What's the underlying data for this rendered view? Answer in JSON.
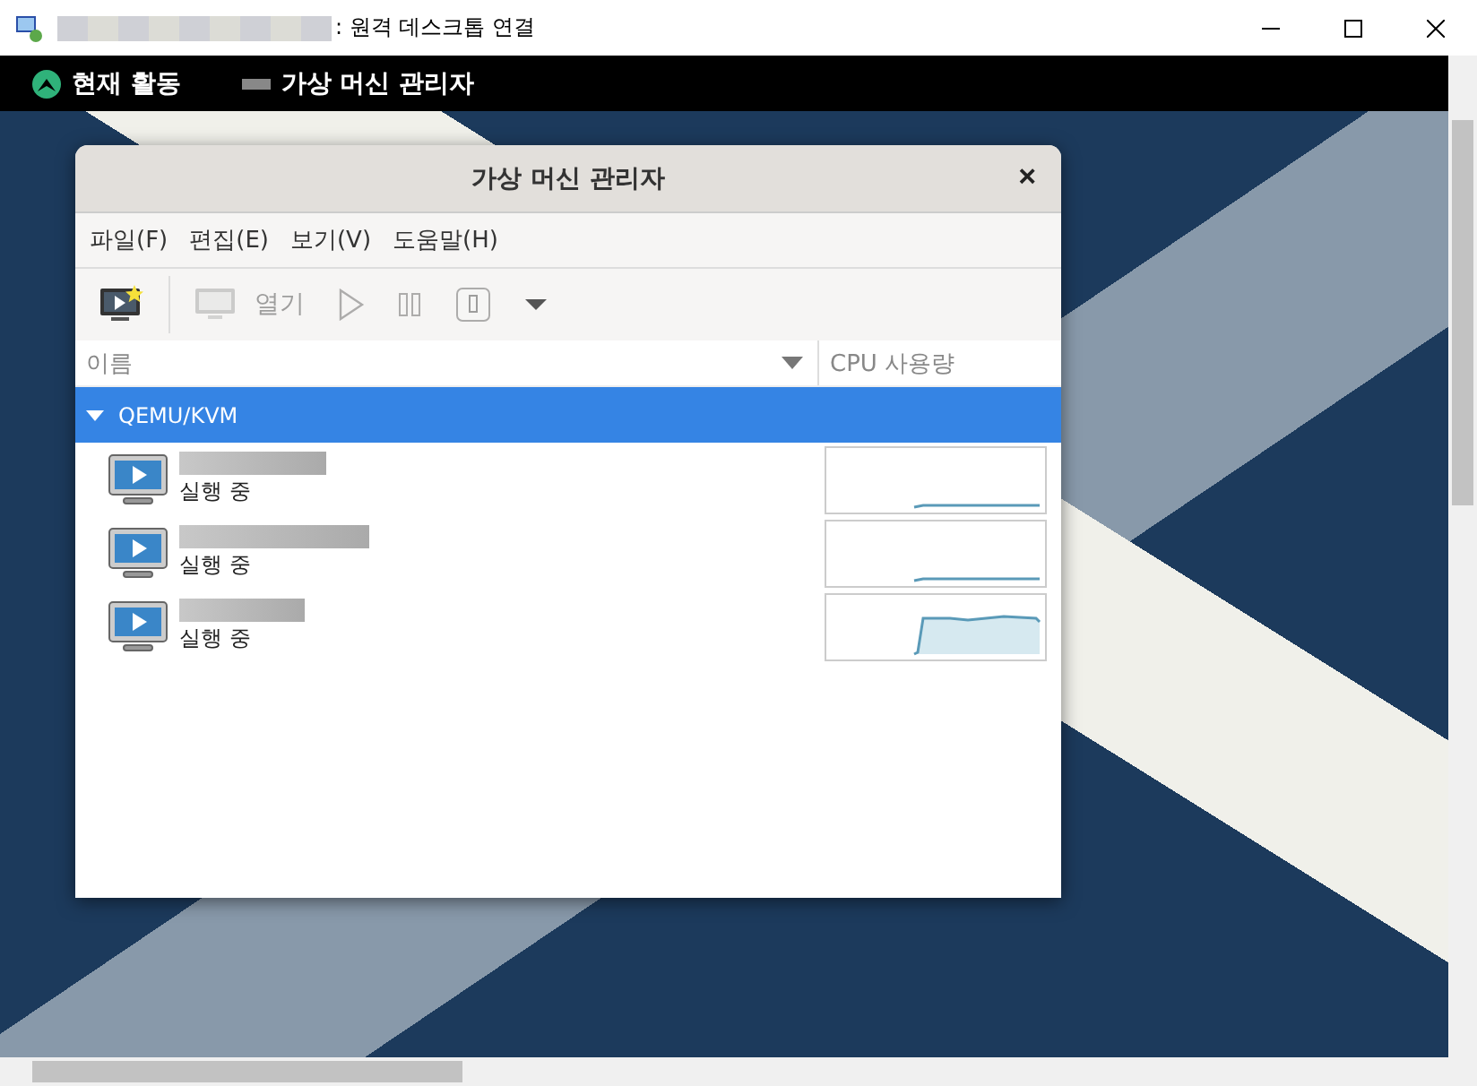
{
  "window": {
    "title": ": 원격 데스크톱 연결"
  },
  "top_bar": {
    "activities": "현재 활동",
    "app_name": "가상 머신 관리자"
  },
  "app_window": {
    "title": "가상 머신 관리자",
    "close": "×"
  },
  "menu": [
    "파일(F)",
    "편집(E)",
    "보기(V)",
    "도움말(H)"
  ],
  "toolbar": [
    {
      "kind": "new",
      "disabled": false
    },
    {
      "kind": "open",
      "label": "열기",
      "disabled": true
    },
    {
      "kind": "run",
      "disabled": true
    },
    {
      "kind": "pause",
      "disabled": true
    },
    {
      "kind": "shutdown",
      "disabled": true
    },
    {
      "kind": "dropdown",
      "disabled": false
    }
  ],
  "columns": [
    "이름",
    "CPU 사용량"
  ],
  "group": {
    "label": "QEMU/KVM",
    "expanded": true,
    "selected": true
  },
  "vms": [
    {
      "status": "실행 중"
    },
    {
      "status": "실행 중"
    },
    {
      "status": "실행 중"
    }
  ]
}
